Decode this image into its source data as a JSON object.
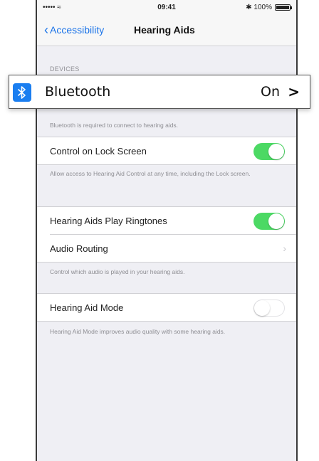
{
  "status_bar": {
    "signal": "••••• ≈",
    "time": "09:41",
    "battery_text": "✱ 100%",
    "battery_level": 1.0
  },
  "nav": {
    "back_label": "Accessibility",
    "title": "Hearing Aids"
  },
  "devices": {
    "header": "DEVICES",
    "bluetooth": {
      "label": "Bluetooth",
      "value": "On"
    },
    "footer": "Bluetooth is required to connect to hearing aids."
  },
  "lock_screen": {
    "label": "Control on Lock Screen",
    "toggle_on": true,
    "footer": "Allow access to Hearing Aid Control at any time, including the Lock screen."
  },
  "ringtones": {
    "label": "Hearing Aids Play Ringtones",
    "toggle_on": true
  },
  "audio_routing": {
    "label": "Audio Routing",
    "footer": "Control which audio is played in your hearing aids."
  },
  "hearing_mode": {
    "label": "Hearing Aid Mode",
    "toggle_on": false,
    "footer": "Hearing Aid Mode improves audio quality with some hearing aids."
  },
  "colors": {
    "accent": "#1a73e8",
    "toggle_on": "#4cd964",
    "bluetooth_icon_bg": "#1a7ef0"
  }
}
